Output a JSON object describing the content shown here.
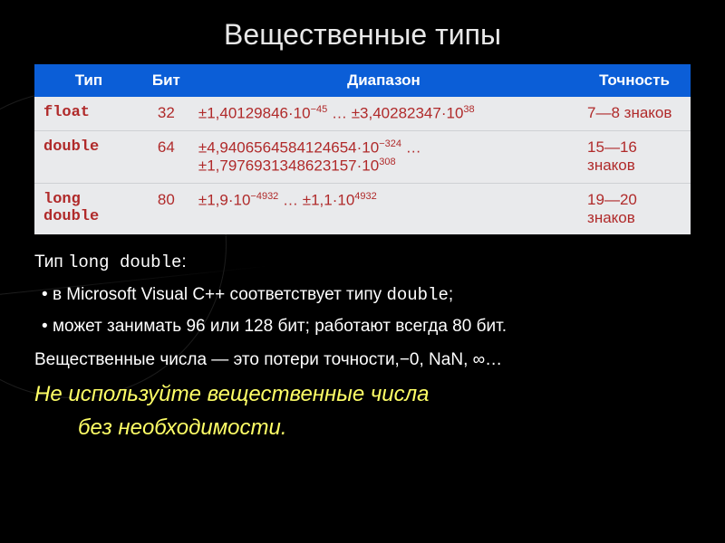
{
  "title": "Вещественные типы",
  "table": {
    "headers": [
      "Тип",
      "Бит",
      "Диапазон",
      "Точность"
    ],
    "rows": [
      {
        "type": "float",
        "bits": "32",
        "range": "±1,40129846·10<span class='sup'>−45</span> … ±3,40282347·10<span class='sup'>38</span>",
        "precision": "7—8 знаков"
      },
      {
        "type": "double",
        "bits": "64",
        "range": "±4,9406564584124654·10<span class='sup'>−324</span> … ±1,7976931348623157·10<span class='sup'>308</span>",
        "precision": "15—16 знаков"
      },
      {
        "type": "long double",
        "bits": "80",
        "range": "±1,9·10<span class='sup'>−4932</span> … ±1,1·10<span class='sup'>4932</span>",
        "precision": "19—20 знаков"
      }
    ]
  },
  "notes": {
    "intro_prefix": "Тип ",
    "intro_code": "long double",
    "intro_suffix": ":",
    "b1_a": "в Microsoft Visual C++ соответствует типу ",
    "b1_code": "double",
    "b1_b": ";",
    "b2": "может занимать 96 или 128 бит; работают всегда 80 бит.",
    "loss": "Вещественные числа — это потери точности,−0, NaN, ∞…",
    "emph1": "Не используйте вещественные числа",
    "emph2": "без необходимости."
  }
}
